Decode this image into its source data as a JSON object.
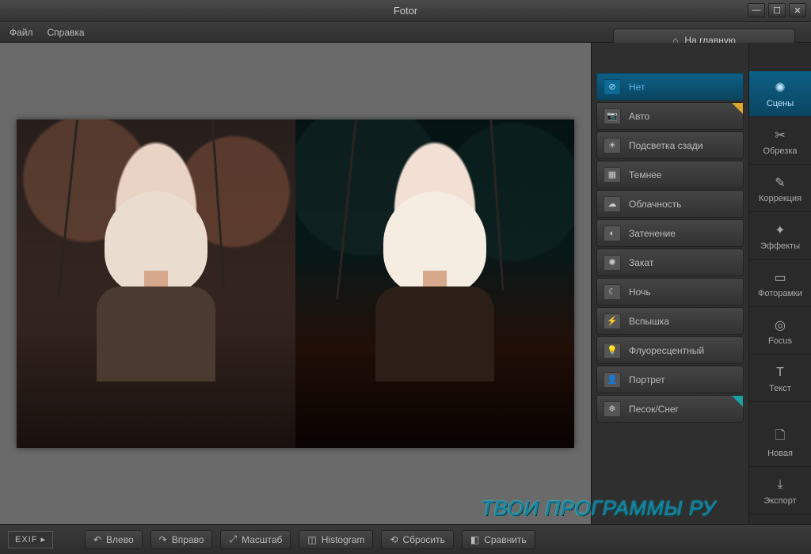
{
  "app_title": "Fotor",
  "menu": {
    "file": "Файл",
    "help": "Справка"
  },
  "home_button": "На главную",
  "scenes": [
    {
      "label": "Нет",
      "icon": "⊘",
      "selected": true
    },
    {
      "label": "Авто",
      "icon": "📷",
      "corner": "gold"
    },
    {
      "label": "Подсветка сзади",
      "icon": "☀"
    },
    {
      "label": "Темнее",
      "icon": "▦"
    },
    {
      "label": "Облачность",
      "icon": "☁"
    },
    {
      "label": "Затенение",
      "icon": "◐"
    },
    {
      "label": "Закат",
      "icon": "✺"
    },
    {
      "label": "Ночь",
      "icon": "☾"
    },
    {
      "label": "Вспышка",
      "icon": "⚡"
    },
    {
      "label": "Флуоресцентный",
      "icon": "💡"
    },
    {
      "label": "Портрет",
      "icon": "👤"
    },
    {
      "label": "Песок/Снег",
      "icon": "❄",
      "corner": "teal"
    }
  ],
  "tools": [
    {
      "label": "Сцены",
      "glyph": "✺",
      "selected": true
    },
    {
      "label": "Обрезка",
      "glyph": "✂"
    },
    {
      "label": "Коррекция",
      "glyph": "✎"
    },
    {
      "label": "Эффекты",
      "glyph": "✦"
    },
    {
      "label": "Фоторамки",
      "glyph": "▭"
    },
    {
      "label": "Focus",
      "glyph": "◎"
    },
    {
      "label": "Текст",
      "glyph": "T"
    },
    {
      "label": "Новая",
      "glyph": "🗋"
    },
    {
      "label": "Экспорт",
      "glyph": "⤓"
    }
  ],
  "bottom": {
    "exif": "EXIF",
    "rotate_left": "Влево",
    "rotate_right": "Вправо",
    "scale": "Масштаб",
    "histogram": "Histogram",
    "reset": "Сбросить",
    "compare": "Сравнить"
  },
  "watermark": "ТВОИ ПРОГРАММЫ РУ"
}
